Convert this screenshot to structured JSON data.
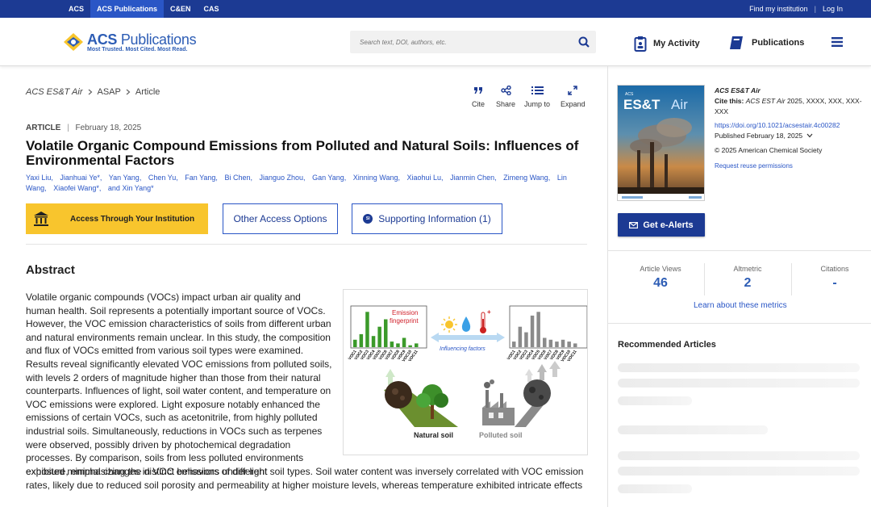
{
  "topbar": {
    "links": [
      "ACS",
      "ACS Publications",
      "C&EN",
      "CAS"
    ],
    "active": "ACS Publications",
    "right": [
      "Find my institution",
      "Log In"
    ]
  },
  "header": {
    "logo_main": "ACS",
    "logo_main2": "Publications",
    "logo_tagline": "Most Trusted. Most Cited. Most Read.",
    "search_placeholder": "Search text, DOI, authors, etc.",
    "my_activity": "My Activity",
    "publications": "Publications"
  },
  "breadcrumb": {
    "journal": "ACS ES&T Air",
    "section": "ASAP",
    "type": "Article"
  },
  "tools": [
    "Cite",
    "Share",
    "Jump to",
    "Expand"
  ],
  "article": {
    "label": "ARTICLE",
    "date": "February 18, 2025",
    "title": "Volatile Organic Compound Emissions from Polluted and Natural Soils: Influences of Environmental Factors",
    "authors": [
      "Yaxi Liu,",
      "Jianhuai Ye*,",
      "Yan Yang,",
      "Chen Yu,",
      "Fan Yang,",
      "Bi Chen,",
      "Jianguo Zhou,",
      "Gan Yang,",
      "Xinning Wang,",
      "Xiaohui Lu,",
      "Jianmin Chen,",
      "Zimeng Wang,",
      "Lin Wang,",
      "Xiaofei Wang*,",
      "and Xin Yang*"
    ]
  },
  "access": {
    "institution": "Access Through Your Institution",
    "other": "Other Access Options",
    "si": "Supporting Information (1)",
    "si_badge": "SI"
  },
  "abstract": {
    "heading": "Abstract",
    "p1": "Volatile organic compounds (VOCs) impact urban air quality and human health. Soil represents a potentially important source of VOCs. However, the VOC emission characteristics of soils from different urban and natural environments remain unclear. In this study, the composition and flux of VOCs emitted from various soil types were examined. Results reveal significantly elevated VOC emissions from polluted soils, with levels 2 orders of magnitude higher than those from their natural counterparts. Influences of light, soil water content, and temperature on VOC emissions were explored. Light exposure notably enhanced the emissions of certain VOCs, such as acetonitrile, from highly polluted industrial soils. Simultaneously, reductions in VOCs such as terpenes were observed, possibly driven by photochemical degradation processes. By comparison, soils from less polluted environments exhibited minimal changes in VOC emissions under light",
    "p2": "exposure, emphasizing the distinct behaviors of different soil types. Soil water content was inversely correlated with VOC emission rates, likely due to reduced soil porosity and permeability at higher moisture levels, whereas temperature exhibited intricate effects"
  },
  "toc": {
    "emission_fingerprint_1": "Emission",
    "emission_fingerprint_2": "fingerprint",
    "influencing_factors": "Influencing factors",
    "natural_soil": "Natural soil",
    "polluted_soil": "Polluted soil",
    "voc_labels": [
      "VOC1",
      "VOC2",
      "VOC3",
      "VOC4",
      "VOC5",
      "VOC6",
      "VOC7",
      "VOC8",
      "VOC9",
      "VOC10",
      "VOC11"
    ],
    "natural_bars": [
      0.2,
      0.35,
      0.95,
      0.3,
      0.55,
      0.75,
      0.15,
      0.1,
      0.25,
      0.05,
      0.1
    ],
    "polluted_bars": [
      0.15,
      0.55,
      0.4,
      0.85,
      0.95,
      0.25,
      0.2,
      0.15,
      0.2,
      0.15,
      0.1
    ]
  },
  "sidebar": {
    "journal": "ACS ES&T Air",
    "cover_top": "ACS",
    "cover_es": "ES&T",
    "cover_air": "Air",
    "cite_label": "Cite this:",
    "cite_journal": "ACS EST Air",
    "cite_rest": "2025, XXXX, XXX, XXX-XXX",
    "doi": "https://doi.org/10.1021/acsestair.4c00282",
    "published": "Published February 18, 2025",
    "copyright": "© 2025 American Chemical Society",
    "reuse": "Request reuse permissions",
    "alerts": "Get e-Alerts",
    "metrics": [
      {
        "label": "Article Views",
        "value": "46"
      },
      {
        "label": "Altmetric",
        "value": "2"
      },
      {
        "label": "Citations",
        "value": "-"
      }
    ],
    "learn": "Learn about these metrics",
    "recommended": "Recommended Articles"
  },
  "colors": {
    "brand": "#1c3a93",
    "accent": "#2a56c6",
    "yellow": "#f8c52d"
  }
}
